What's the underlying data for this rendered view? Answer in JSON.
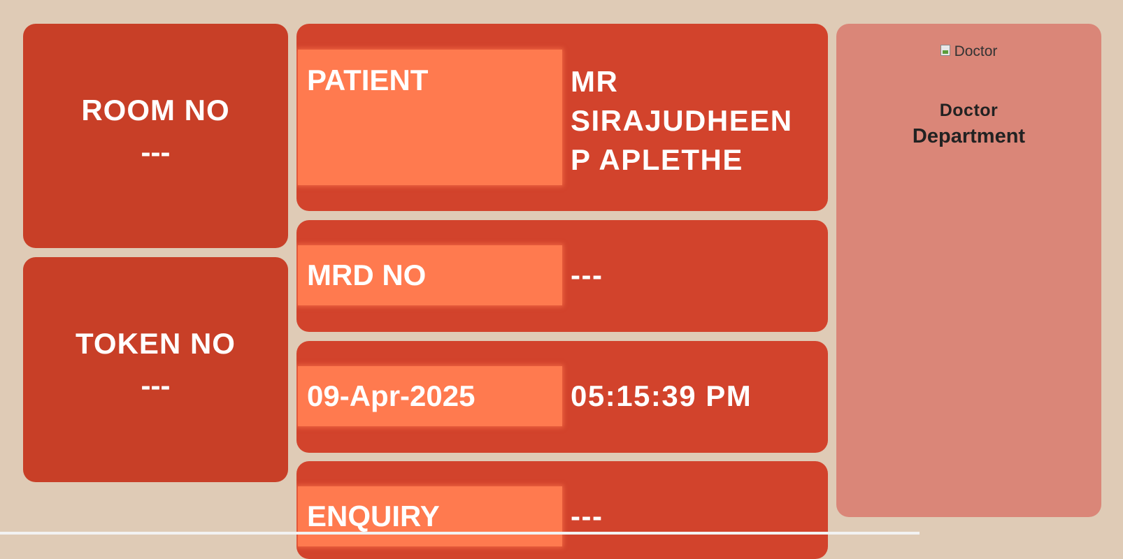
{
  "room": {
    "label": "ROOM NO",
    "value": "---"
  },
  "token": {
    "label": "TOKEN NO",
    "value": "---"
  },
  "patient": {
    "label": "PATIENT",
    "line1": "MR",
    "line2": "SIRAJUDHEEN",
    "line3": "P APLETHE"
  },
  "mrd": {
    "label": "MRD NO",
    "value": "---"
  },
  "datetime": {
    "date": "09-Apr-2025",
    "time": "05:15:39 PM"
  },
  "enquiry": {
    "label": "ENQUIRY",
    "value": "---"
  },
  "doctor": {
    "photo_alt": "Doctor",
    "name": "Doctor",
    "department": "Department"
  },
  "colors": {
    "background": "#dfcbb6",
    "card_dark": "#c83f27",
    "card_mid": "#d2432c",
    "key_highlight": "#ff7a4f",
    "doctor_panel": "#da8678"
  }
}
